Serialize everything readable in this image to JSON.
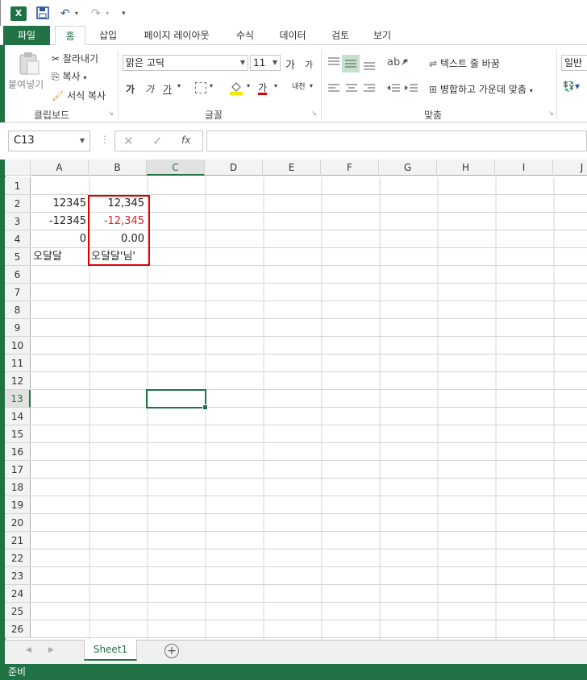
{
  "ribbon_tabs": [
    "파일",
    "홈",
    "삽입",
    "페이지 레이아웃",
    "수식",
    "데이터",
    "검토",
    "보기"
  ],
  "clipboard": {
    "paste": "붙여넣기",
    "cut": "잘라내기",
    "copy": "복사",
    "format_painter": "서식 복사",
    "group_label": "클립보드"
  },
  "font": {
    "name": "맑은 고딕",
    "size": "11",
    "group_label": "글꼴",
    "grow": "가",
    "shrink": "가",
    "bold": "가",
    "italic": "가",
    "underline": "가",
    "color_btn": "가",
    "phonetic": "내천"
  },
  "alignment": {
    "wrap_text": "텍스트 줄 바꿈",
    "merge_center": "병합하고 가운데 맞춤",
    "group_label": "맞춤"
  },
  "number": {
    "format": "일반"
  },
  "formula_bar": {
    "name_box": "C13",
    "fx": "fx",
    "value": ""
  },
  "columns": [
    "A",
    "B",
    "C",
    "D",
    "E",
    "F",
    "G",
    "H",
    "I",
    "J"
  ],
  "rows": [
    "1",
    "2",
    "3",
    "4",
    "5",
    "6",
    "7",
    "8",
    "9",
    "10",
    "11",
    "12",
    "13",
    "14",
    "15",
    "16",
    "17",
    "18",
    "19",
    "20",
    "21",
    "22",
    "23",
    "24",
    "25",
    "26"
  ],
  "cells": {
    "A2": "12345",
    "B2": "12,345",
    "A3": "-12345",
    "B3": "-12,345",
    "A4": "0",
    "B4": "0.00",
    "A5": "오달달",
    "B5": "오달달'님'"
  },
  "sheet_tab": "Sheet1",
  "status": "준비",
  "colors": {
    "excel_green": "#217346",
    "negative_red": "#e02020",
    "highlight_border": "#e00000"
  }
}
